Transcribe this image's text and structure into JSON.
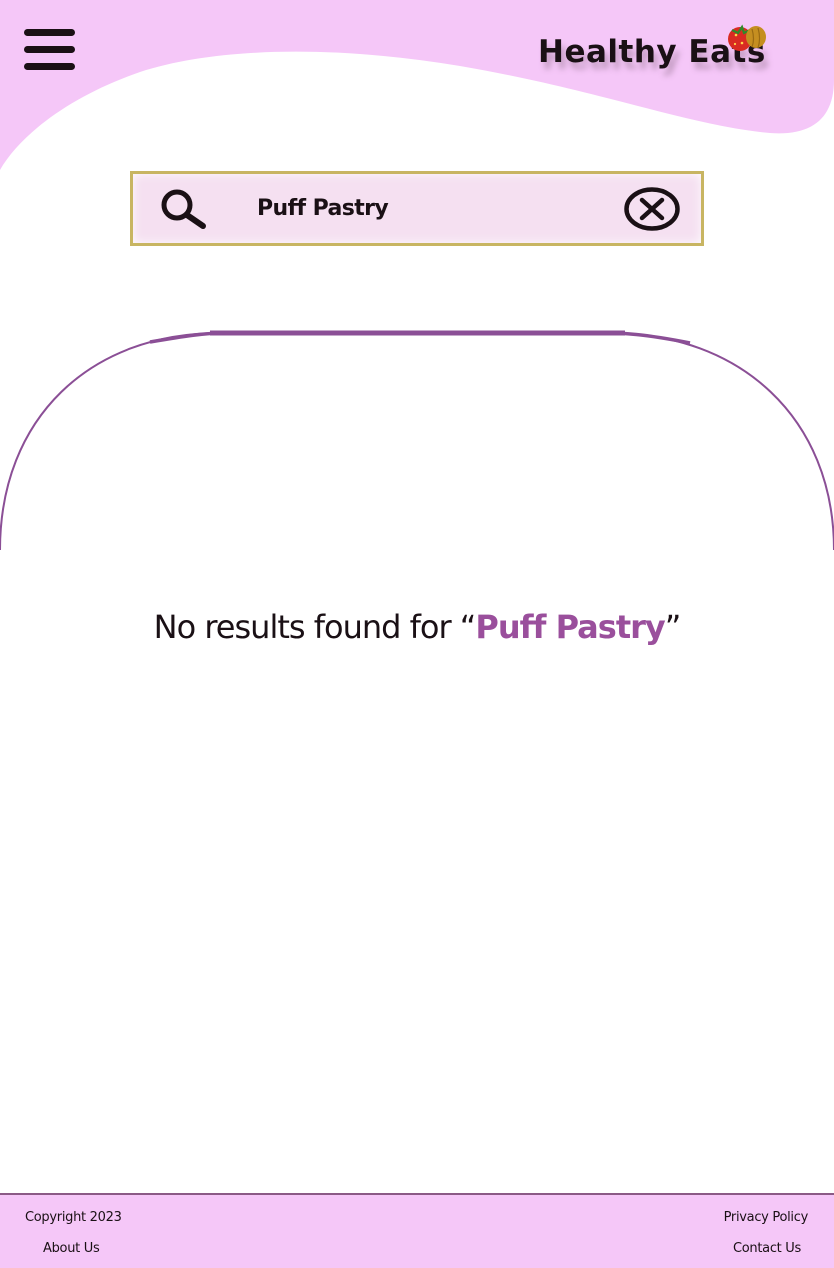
{
  "header": {
    "brand_name": "Healthy Eats",
    "menu_icon": "hamburger-menu-icon",
    "brand_icon": "fruit-icon"
  },
  "search": {
    "value": "Puff Pastry",
    "search_icon": "search-icon",
    "clear_icon": "clear-icon"
  },
  "results": {
    "message_prefix": "No results found for “",
    "query": "Puff Pastry",
    "message_suffix": "”"
  },
  "footer": {
    "copyright": "Copyright 2023",
    "about": "About Us",
    "privacy": "Privacy Policy",
    "contact": "Contact Us"
  },
  "colors": {
    "header_bg": "#f5c7f8",
    "search_bg": "#f5e0f1",
    "search_border": "#c8b562",
    "accent": "#9a4f9c",
    "arch_stroke": "#8b4f96",
    "footer_bg": "#f5c7f8"
  }
}
